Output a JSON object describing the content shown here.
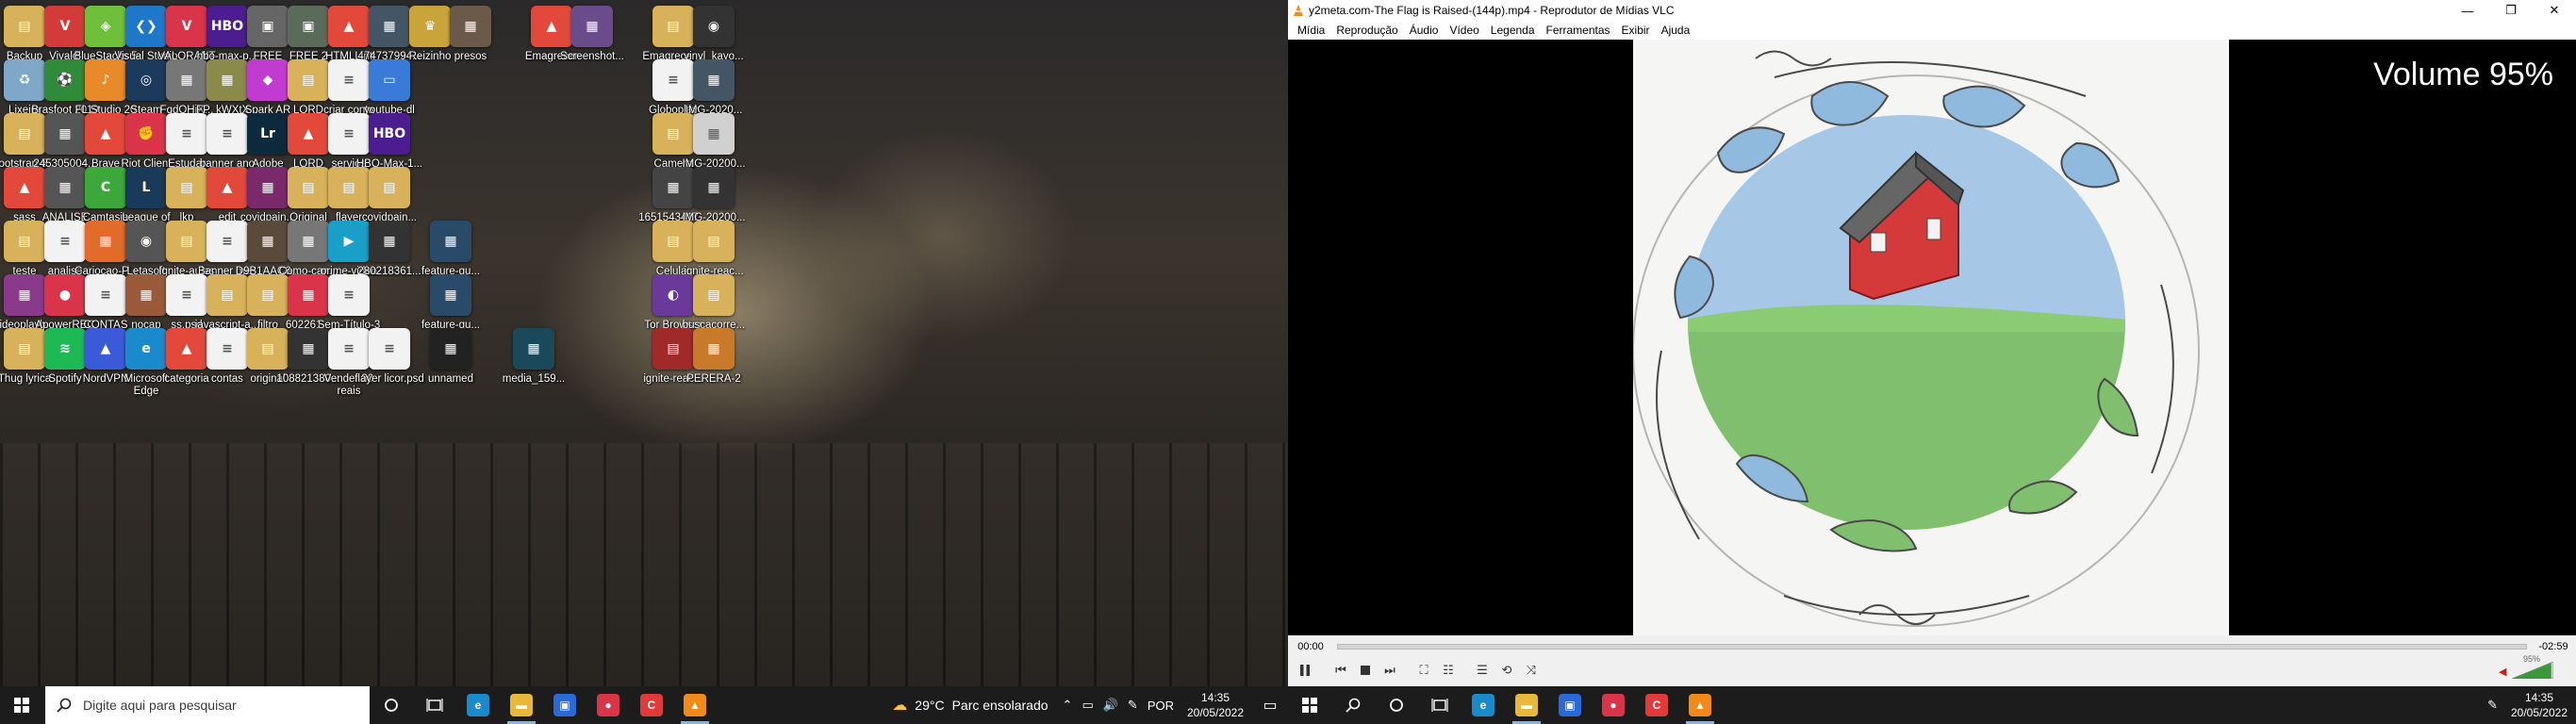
{
  "desktop": {
    "icons": [
      {
        "label": "Backup",
        "color": "#d8b25a",
        "glyph": "▤"
      },
      {
        "label": "Vivaldi",
        "color": "#d33b3b",
        "glyph": "V"
      },
      {
        "label": "BlueStacks 5",
        "color": "#6fbf3a",
        "glyph": "◈"
      },
      {
        "label": "Visual Studio Code",
        "color": "#1f77c9",
        "glyph": "❮❯"
      },
      {
        "label": "VALORANT",
        "color": "#d9344a",
        "glyph": "V"
      },
      {
        "label": "hbo-max-p...",
        "color": "#4b1d8e",
        "glyph": "HBO"
      },
      {
        "label": "FREE",
        "color": "#666666",
        "glyph": "▣"
      },
      {
        "label": "FREE 2",
        "color": "#5a6b5a",
        "glyph": "▣"
      },
      {
        "label": "HTMLLint HTML Form...",
        "color": "#e2493b",
        "glyph": "▲"
      },
      {
        "label": "474737994...",
        "color": "#445566",
        "glyph": "▦"
      },
      {
        "label": "Reizinho",
        "color": "#c9a43a",
        "glyph": "♛"
      },
      {
        "label": "presos",
        "color": "#6b5a4a",
        "glyph": "▦"
      },
      {
        "label": "Emagrecer",
        "color": "#e2493b",
        "glyph": "▲"
      },
      {
        "label": "Screenshot...",
        "color": "#6a4c8a",
        "glyph": "▦"
      },
      {
        "label": "Emagrecer...",
        "color": "#d8b25a",
        "glyph": "▤"
      },
      {
        "label": "vinyl_kayo...",
        "color": "#333333",
        "glyph": "◉"
      },
      {
        "label": "Lixeira",
        "color": "#7fa8c8",
        "glyph": "♻"
      },
      {
        "label": "Brasfoot 2019",
        "color": "#2f8a3a",
        "glyph": "⚽"
      },
      {
        "label": "FL Studio 20",
        "color": "#e88a2a",
        "glyph": "♪"
      },
      {
        "label": "Steam",
        "color": "#1b3a5c",
        "glyph": "◎"
      },
      {
        "label": "FqdOHjX...",
        "color": "#777777",
        "glyph": "▦"
      },
      {
        "label": "FP_kWXtX...",
        "color": "#8a8a4a",
        "glyph": "▦"
      },
      {
        "label": "Spark AR Studio v135",
        "color": "#c23bd1",
        "glyph": "◆"
      },
      {
        "label": "LORD VINHETEIR...",
        "color": "#d8b25a",
        "glyph": "▤"
      },
      {
        "label": "criar conta",
        "color": "#f2f2f2",
        "glyph": "≡",
        "dark": true
      },
      {
        "label": "youtube-dl",
        "color": "#3a7ad8",
        "glyph": "▭"
      },
      {
        "label": "Globoplay direct go",
        "color": "#f2f2f2",
        "glyph": "≡",
        "dark": true
      },
      {
        "label": "IMG-2020...",
        "color": "#445566",
        "glyph": "▦"
      },
      {
        "label": "bootstrap-5...",
        "color": "#d8b25a",
        "glyph": "▤"
      },
      {
        "label": "245305004...",
        "color": "#555555",
        "glyph": "▦"
      },
      {
        "label": "Brave",
        "color": "#e2493b",
        "glyph": "▲"
      },
      {
        "label": "Riot Client",
        "color": "#d9344a",
        "glyph": "✊"
      },
      {
        "label": "Estudar",
        "color": "#f2f2f2",
        "glyph": "≡",
        "dark": true
      },
      {
        "label": "banner ano editavel.psd",
        "color": "#f2f2f2",
        "glyph": "≡",
        "dark": true
      },
      {
        "label": "Adobe Lightroo...",
        "color": "#0d2a3d",
        "glyph": "Lr"
      },
      {
        "label": "LORD VINHETEIR...",
        "color": "#e2493b",
        "glyph": "▲"
      },
      {
        "label": "servios streaming",
        "color": "#f2f2f2",
        "glyph": "≡",
        "dark": true
      },
      {
        "label": "HBO-Max-1...",
        "color": "#4b1d8e",
        "glyph": "HBO"
      },
      {
        "label": "Camera",
        "color": "#d8b25a",
        "glyph": "▤"
      },
      {
        "label": "IMG-20200...",
        "color": "#d0d0d0",
        "glyph": "▦",
        "dark": true
      },
      {
        "label": "sass",
        "color": "#e2493b",
        "glyph": "▲"
      },
      {
        "label": "ANALISE",
        "color": "#555555",
        "glyph": "▦"
      },
      {
        "label": "Camtasia 2021",
        "color": "#3ca83a",
        "glyph": "C"
      },
      {
        "label": "League of Legends",
        "color": "#1a3a5a",
        "glyph": "L"
      },
      {
        "label": "lkp",
        "color": "#d8b25a",
        "glyph": "▤"
      },
      {
        "label": "edit",
        "color": "#e2493b",
        "glyph": "▲"
      },
      {
        "label": "covidpain...",
        "color": "#7a2a6a",
        "glyph": "▦"
      },
      {
        "label": "Original",
        "color": "#d8b25a",
        "glyph": "▤"
      },
      {
        "label": "flayer",
        "color": "#d8b25a",
        "glyph": "▤"
      },
      {
        "label": "covidpain...",
        "color": "#d8b25a",
        "glyph": "▤"
      },
      {
        "label": "1651543417...",
        "color": "#444444",
        "glyph": "▦"
      },
      {
        "label": "IMG-20200...",
        "color": "#333333",
        "glyph": "▦"
      },
      {
        "label": "teste",
        "color": "#d8b25a",
        "glyph": "▤"
      },
      {
        "label": "analise ds4ever",
        "color": "#f2f2f2",
        "glyph": "≡",
        "dark": true
      },
      {
        "label": "Cariocao-P...",
        "color": "#e26a2a",
        "glyph": "▦"
      },
      {
        "label": "Letasoft Soun...",
        "color": "#555555",
        "glyph": "◉"
      },
      {
        "label": "Ignite-aulas",
        "color": "#d8b25a",
        "glyph": "▤"
      },
      {
        "label": "Banner mes editavel.psd",
        "color": "#f2f2f2",
        "glyph": "≡",
        "dark": true
      },
      {
        "label": "D9B1AAC6...",
        "color": "#5a4a3a",
        "glyph": "▦"
      },
      {
        "label": "Como-can...",
        "color": "#777777",
        "glyph": "▦"
      },
      {
        "label": "prime-video",
        "color": "#1aa0c8",
        "glyph": "▶"
      },
      {
        "label": "280218361...",
        "color": "#333333",
        "glyph": "▦"
      },
      {
        "label": "feature-gu...",
        "color": "#2a4a6a",
        "glyph": "▦"
      },
      {
        "label": "Celular backup",
        "color": "#d8b25a",
        "glyph": "▤"
      },
      {
        "label": "ignite-reac...",
        "color": "#d8b25a",
        "glyph": "▤"
      },
      {
        "label": "videoplayb...",
        "color": "#8a3a8a",
        "glyph": "▦"
      },
      {
        "label": "ApowerREC",
        "color": "#d9344a",
        "glyph": "●"
      },
      {
        "label": "CONTAS FORUM.psd",
        "color": "#f2f2f2",
        "glyph": "≡",
        "dark": true
      },
      {
        "label": "nocap",
        "color": "#9a5a3a",
        "glyph": "▦"
      },
      {
        "label": "ss.psd",
        "color": "#f2f2f2",
        "glyph": "≡",
        "dark": true
      },
      {
        "label": "javascript-a...",
        "color": "#d8b25a",
        "glyph": "▤"
      },
      {
        "label": "filtro",
        "color": "#d8b25a",
        "glyph": "▤"
      },
      {
        "label": "602261...",
        "color": "#d9344a",
        "glyph": "▦"
      },
      {
        "label": "Sem-Título-3",
        "color": "#f2f2f2",
        "glyph": "≡",
        "dark": true
      },
      {
        "label": "feature-gu...",
        "color": "#2a4a6a",
        "glyph": "▦"
      },
      {
        "label": "Tor Browser",
        "color": "#6a3a9a",
        "glyph": "◐"
      },
      {
        "label": "buscacorre...",
        "color": "#d8b25a",
        "glyph": "▤"
      },
      {
        "label": "Thug lyrica",
        "color": "#d8b25a",
        "glyph": "▤"
      },
      {
        "label": "Spotify",
        "color": "#1db954",
        "glyph": "≋"
      },
      {
        "label": "NordVPN",
        "color": "#3a5ad8",
        "glyph": "▲"
      },
      {
        "label": "Microsoft Edge",
        "color": "#1a8acb",
        "glyph": "e"
      },
      {
        "label": "categoria",
        "color": "#e2493b",
        "glyph": "▲"
      },
      {
        "label": "contas",
        "color": "#f2f2f2",
        "glyph": "≡",
        "dark": true
      },
      {
        "label": "original",
        "color": "#d8b25a",
        "glyph": "▤"
      },
      {
        "label": "108821380...",
        "color": "#333333",
        "glyph": "▦"
      },
      {
        "label": "Vender 30 reais",
        "color": "#f2f2f2",
        "glyph": "≡",
        "dark": true
      },
      {
        "label": "flayer licor.psd",
        "color": "#f2f2f2",
        "glyph": "≡",
        "dark": true
      },
      {
        "label": "unnamed",
        "color": "#222222",
        "glyph": "▦"
      },
      {
        "label": "media_159...",
        "color": "#1a4a5a",
        "glyph": "▦"
      },
      {
        "label": "ignite-reac...",
        "color": "#a02a2a",
        "glyph": "▤"
      },
      {
        "label": "PERERA-2",
        "color": "#c87a2a",
        "glyph": "▦"
      }
    ]
  },
  "taskbar_left": {
    "search_placeholder": "Digite aqui para pesquisar",
    "weather_temp": "29°C",
    "weather_text": "Parc ensolarado",
    "lang": "POR",
    "time": "14:35",
    "date": "20/05/2022",
    "apps": [
      {
        "name": "edge",
        "color": "#1a8acb",
        "glyph": "e"
      },
      {
        "name": "explorer",
        "color": "#e8b83a",
        "glyph": "▬"
      },
      {
        "name": "store",
        "color": "#2a6ad8",
        "glyph": "▣"
      },
      {
        "name": "apowerrec",
        "color": "#d9344a",
        "glyph": "●"
      },
      {
        "name": "camtasia",
        "color": "#e03a3a",
        "glyph": "C"
      },
      {
        "name": "vlc",
        "color": "#f08a1a",
        "glyph": "▲"
      }
    ]
  },
  "vlc": {
    "window_title": "y2meta.com-The Flag is Raised-(144p).mp4 - Reprodutor de Mídias VLC",
    "menu": [
      "Mídia",
      "Reprodução",
      "Áudio",
      "Vídeo",
      "Legenda",
      "Ferramentas",
      "Exibir",
      "Ajuda"
    ],
    "osd_text": "Volume 95%",
    "time_elapsed": "00:00",
    "time_remaining": "-02:59",
    "seek_position": 0.0,
    "volume_level": 0.95,
    "volume_label": "95%"
  },
  "taskbar_right": {
    "time": "14:35",
    "date": "20/05/2022",
    "apps": [
      {
        "name": "edge",
        "color": "#1a8acb",
        "glyph": "e"
      },
      {
        "name": "explorer",
        "color": "#e8b83a",
        "glyph": "▬"
      },
      {
        "name": "store",
        "color": "#2a6ad8",
        "glyph": "▣"
      },
      {
        "name": "apowerrec",
        "color": "#d9344a",
        "glyph": "●"
      },
      {
        "name": "camtasia",
        "color": "#e03a3a",
        "glyph": "C"
      },
      {
        "name": "vlc",
        "color": "#f08a1a",
        "glyph": "▲"
      }
    ]
  }
}
